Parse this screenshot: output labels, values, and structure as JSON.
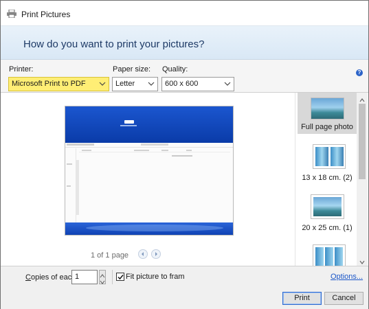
{
  "window": {
    "title": "Print Pictures",
    "icon": "printer-icon"
  },
  "header": {
    "question": "How do you want to print your pictures?"
  },
  "settings": {
    "printer_label": "Printer:",
    "printer_value": "Microsoft Print to PDF",
    "paper_label": "Paper size:",
    "paper_value": "Letter",
    "quality_label": "Quality:",
    "quality_value": "600 x 600",
    "highlight_color": "#ffee75",
    "help_icon": "help-icon"
  },
  "preview": {
    "page_status": "1 of 1 page",
    "prev_icon": "previous-page-icon",
    "next_icon": "next-page-icon"
  },
  "layouts": [
    {
      "label": "Full page photo",
      "selected": true
    },
    {
      "label": "13 x 18 cm. (2)",
      "selected": false
    },
    {
      "label": "20 x 25 cm. (1)",
      "selected": false
    },
    {
      "label": "",
      "selected": false
    }
  ],
  "bottom": {
    "copies_label": "Copies of each",
    "copies_value": "1",
    "fit_label": "Fit picture to fram",
    "fit_checked": true,
    "options_link": "Options...",
    "print_button": "Print",
    "cancel_button": "Cancel"
  }
}
